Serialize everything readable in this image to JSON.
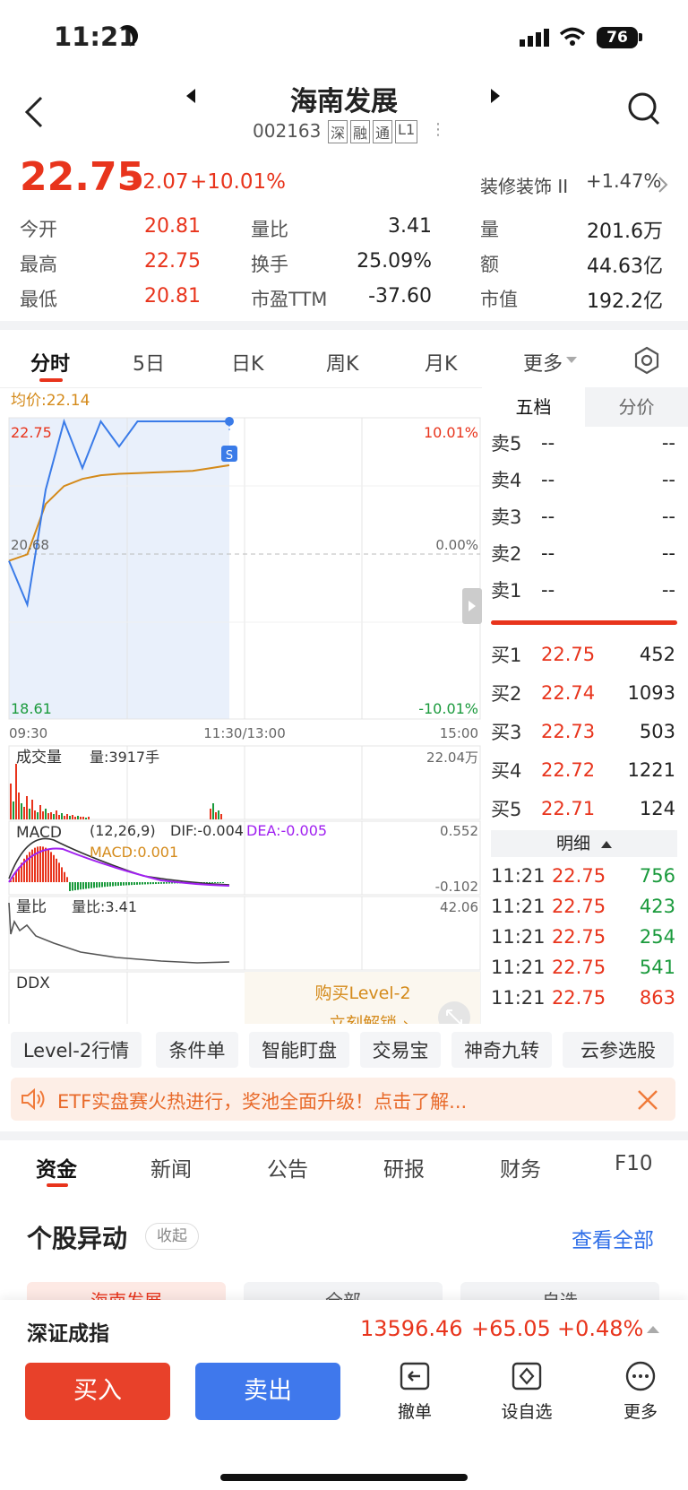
{
  "status": {
    "time": "11:21",
    "battery": "76"
  },
  "header": {
    "title": "海南发展",
    "code": "002163",
    "tags": [
      "深",
      "融",
      "通",
      "L1"
    ]
  },
  "quote": {
    "price": "22.75",
    "change": "+2.07",
    "pct": "+10.01%",
    "sector": "装修装饰 II",
    "sector_pct": "+1.47%"
  },
  "stats": [
    {
      "label": "今开",
      "value": "20.81"
    },
    {
      "label": "量比",
      "value": "3.41"
    },
    {
      "label": "量",
      "value": "201.6万"
    },
    {
      "label": "最高",
      "value": "22.75"
    },
    {
      "label": "换手",
      "value": "25.09%"
    },
    {
      "label": "额",
      "value": "44.63亿"
    },
    {
      "label": "最低",
      "value": "20.81"
    },
    {
      "label": "市盈TTM",
      "value": "-37.60"
    },
    {
      "label": "市值",
      "value": "192.2亿"
    }
  ],
  "tabs": [
    "分时",
    "5日",
    "日K",
    "周K",
    "月K",
    "更多"
  ],
  "chart": {
    "avg_label": "均价:22.14",
    "high": "22.75",
    "mid": "20.68",
    "low": "18.61",
    "pct_high": "10.01%",
    "pct_mid": "0.00%",
    "pct_low": "-10.01%",
    "time_start": "09:30",
    "time_mid": "11:30/13:00",
    "time_end": "15:00",
    "sell_marker": "S",
    "vol_title": "成交量",
    "vol_text": "量:3917手",
    "vol_max": "22.04万",
    "macd_title": "MACD",
    "macd_params": "(12,26,9)",
    "dif": "DIF:-0.004",
    "dea": "DEA:-0.005",
    "macd": "MACD:0.001",
    "macd_max": "0.552",
    "macd_min": "-0.102",
    "lb_title": "量比",
    "lb_text": "量比:3.41",
    "lb_max": "42.06",
    "ddx_title": "DDX",
    "buy_l2": "购买Level-2",
    "unlock": "立刻解锁 ›"
  },
  "chart_data": {
    "type": "line",
    "x_range": [
      "09:30",
      "15:00"
    ],
    "ylim": [
      18.61,
      22.75
    ],
    "series": [
      {
        "name": "价格",
        "values": [
          20.81,
          20.2,
          21.8,
          22.75,
          22.1,
          22.75,
          22.4,
          22.75,
          22.75,
          22.75,
          22.75,
          22.75,
          22.75
        ]
      },
      {
        "name": "均价",
        "values": [
          20.81,
          20.9,
          21.6,
          21.85,
          21.95,
          22.0,
          22.02,
          22.03,
          22.04,
          22.05,
          22.06,
          22.1,
          22.14
        ]
      }
    ]
  },
  "orderbook": {
    "tabs": [
      "五档",
      "分价"
    ],
    "asks": [
      {
        "l": "卖5",
        "p": "--",
        "v": "--"
      },
      {
        "l": "卖4",
        "p": "--",
        "v": "--"
      },
      {
        "l": "卖3",
        "p": "--",
        "v": "--"
      },
      {
        "l": "卖2",
        "p": "--",
        "v": "--"
      },
      {
        "l": "卖1",
        "p": "--",
        "v": "--"
      }
    ],
    "bids": [
      {
        "l": "买1",
        "p": "22.75",
        "v": "452"
      },
      {
        "l": "买2",
        "p": "22.74",
        "v": "1093"
      },
      {
        "l": "买3",
        "p": "22.73",
        "v": "503"
      },
      {
        "l": "买4",
        "p": "22.72",
        "v": "1221"
      },
      {
        "l": "买5",
        "p": "22.71",
        "v": "124"
      }
    ],
    "detail_label": "明细",
    "details": [
      {
        "t": "11:21",
        "p": "22.75",
        "v": "756"
      },
      {
        "t": "11:21",
        "p": "22.75",
        "v": "423"
      },
      {
        "t": "11:21",
        "p": "22.75",
        "v": "254"
      },
      {
        "t": "11:21",
        "p": "22.75",
        "v": "541"
      },
      {
        "t": "11:21",
        "p": "22.75",
        "v": "863"
      }
    ]
  },
  "chips": [
    "Level-2行情",
    "条件单",
    "智能盯盘",
    "交易宝",
    "神奇九转",
    "云参选股"
  ],
  "banner": "ETF实盘赛火热进行，奖池全面升级！点击了解...",
  "subtabs": [
    "资金",
    "新闻",
    "公告",
    "研报",
    "财务",
    "F10"
  ],
  "section": {
    "title": "个股异动",
    "collapse": "收起",
    "view_all": "查看全部",
    "peek": [
      "海南发展",
      "全部",
      "自选"
    ]
  },
  "index": {
    "name": "深证成指",
    "value": "13596.46",
    "change": "+65.05",
    "pct": "+0.48%"
  },
  "bottom": {
    "buy": "买入",
    "sell": "卖出",
    "actions": [
      "撤单",
      "设自选",
      "更多"
    ]
  }
}
